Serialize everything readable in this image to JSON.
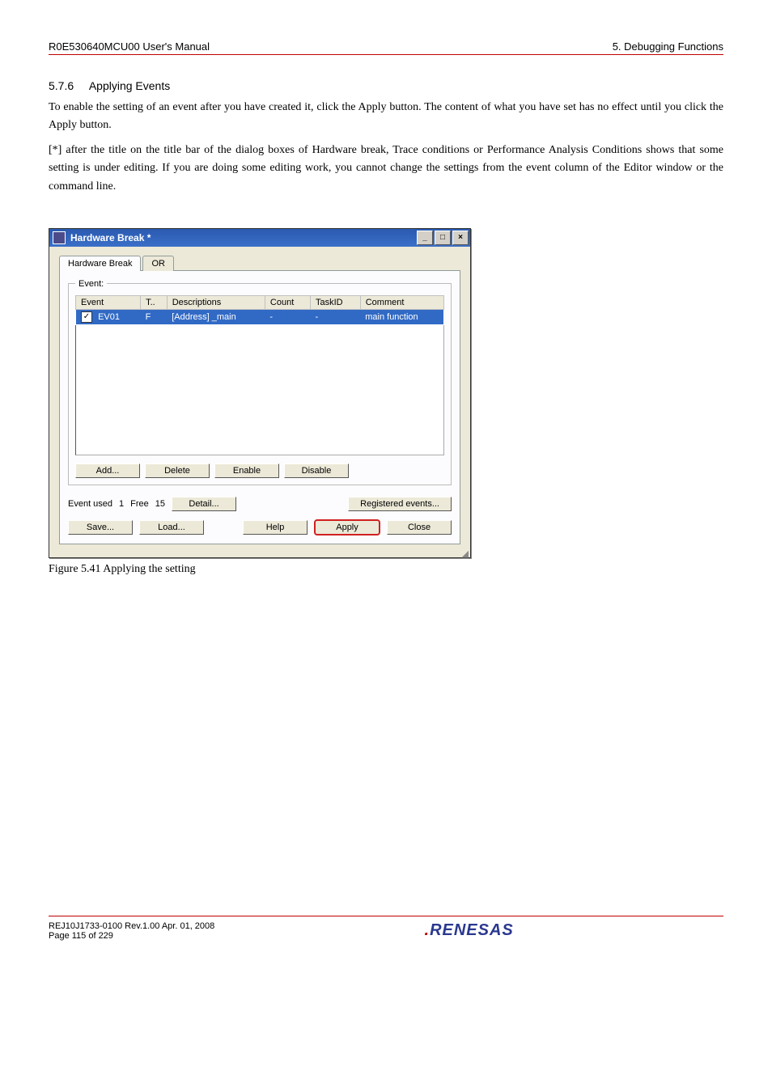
{
  "header": {
    "left": "R0E530640MCU00 User's Manual",
    "right": "5. Debugging Functions"
  },
  "section": {
    "number": "5.7.6",
    "title": "Applying Events"
  },
  "paragraphs": {
    "p1": "To enable the setting of an event after you have created it, click the Apply button. The content of what you have set has no effect until you click the Apply button.",
    "p2": "[*] after the title on the title bar of the dialog boxes of Hardware break, Trace conditions or Performance Analysis Conditions shows that some setting is under editing. If you are doing some editing work, you cannot change the settings from the event column of the Editor window or the command line."
  },
  "dialog": {
    "title": "Hardware Break *",
    "tabs": {
      "t1": "Hardware Break",
      "t2": "OR"
    },
    "legend": "Event:",
    "columns": {
      "c1": "Event",
      "c2": "T..",
      "c3": "Descriptions",
      "c4": "Count",
      "c5": "TaskID",
      "c6": "Comment"
    },
    "row": {
      "event": "EV01",
      "type": "F",
      "desc": "[Address] _main",
      "count": "-",
      "task": "-",
      "comment": "main function"
    },
    "buttons": {
      "add": "Add...",
      "delete": "Delete",
      "enable": "Enable",
      "disable": "Disable",
      "detail": "Detail...",
      "registered": "Registered events...",
      "save": "Save...",
      "load": "Load...",
      "help": "Help",
      "apply": "Apply",
      "close": "Close"
    },
    "status": {
      "eventused_label": "Event used",
      "eventused_val": "1",
      "free_label": "Free",
      "free_val": "15"
    }
  },
  "figure_caption": "Figure 5.41 Applying the setting",
  "footer": {
    "line1": "REJ10J1733-0100   Rev.1.00   Apr. 01, 2008",
    "line2": "Page 115 of 229",
    "logo": "RENESAS"
  }
}
